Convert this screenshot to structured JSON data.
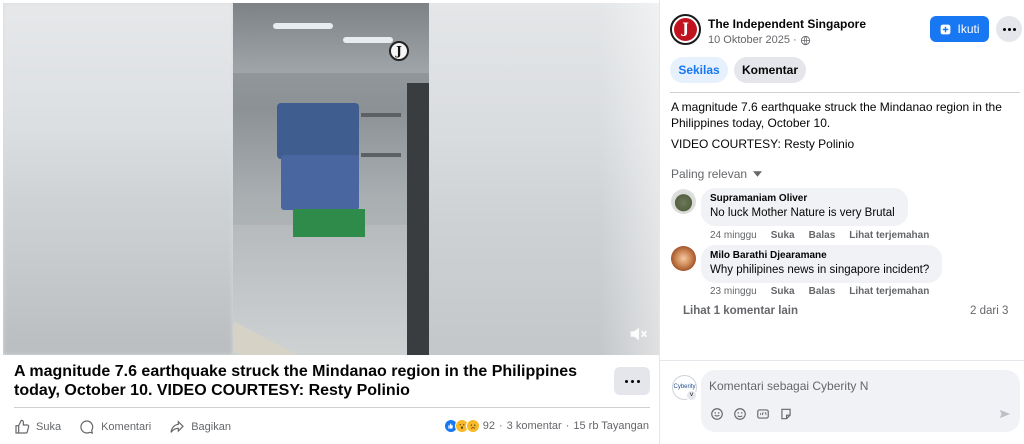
{
  "video": {
    "logo_letter": "J"
  },
  "post": {
    "caption": "A magnitude 7.6 earthquake struck the Mindanao region in the Philippines today, October 10. VIDEO COURTESY: Resty Polinio",
    "actions": {
      "like": "Suka",
      "comment": "Komentari",
      "share": "Bagikan"
    },
    "stats": {
      "reaction_count": "92",
      "comments": "3 komentar",
      "views": "15 rb Tayangan"
    }
  },
  "page": {
    "name": "The Independent Singapore",
    "avatar_letter": "J",
    "date": "10 Oktober 2025",
    "follow_label": "Ikuti"
  },
  "tabs": {
    "summary": "Sekilas",
    "comments": "Komentar"
  },
  "description": {
    "line1": "A magnitude 7.6 earthquake struck the Mindanao region in the Philippines today, October 10.",
    "line2": "VIDEO COURTESY: Resty Polinio"
  },
  "sort_label": "Paling relevan",
  "comments": [
    {
      "author": "Supramaniam Oliver",
      "text": "No luck Mother Nature is very Brutal",
      "time": "24 minggu",
      "like": "Suka",
      "reply": "Balas",
      "translate": "Lihat terjemahan"
    },
    {
      "author": "Milo Barathi Djearamane",
      "text": "Why philipines news in singapore incident?",
      "time": "23 minggu",
      "like": "Suka",
      "reply": "Balas",
      "translate": "Lihat terjemahan"
    }
  ],
  "more_comments": "Lihat 1 komentar lain",
  "pager": "2 dari 3",
  "composer": {
    "placeholder": "Komentari sebagai Cyberity N",
    "avatar_label": "Cyberity"
  },
  "colors": {
    "accent": "#1877f2",
    "text_primary": "#050505",
    "text_secondary": "#65676b",
    "bubble_bg": "#f0f2f5"
  },
  "icons": [
    "volume-off-icon",
    "more-icon",
    "like-icon",
    "comment-icon",
    "share-icon",
    "globe-icon",
    "follow-plus-icon",
    "chevron-down-icon",
    "sticker-icon",
    "emoji-icon",
    "gif-icon",
    "avatar-sticker-icon",
    "send-icon"
  ]
}
